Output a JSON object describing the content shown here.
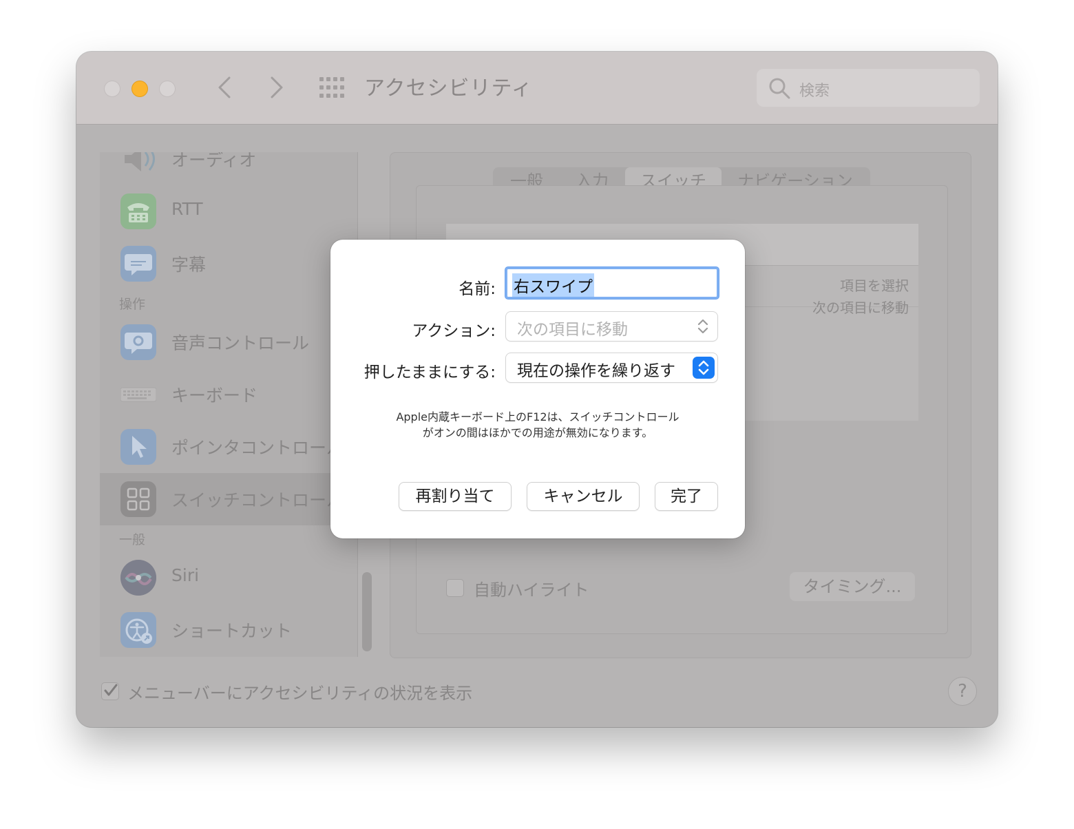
{
  "window": {
    "title": "アクセシビリティ",
    "search_placeholder": "検索"
  },
  "sidebar": {
    "items": [
      {
        "label": "オーディオ",
        "icon": "speaker-icon"
      },
      {
        "label": "RTT",
        "icon": "telephone-icon"
      },
      {
        "label": "字幕",
        "icon": "caption-bubble-icon"
      },
      {
        "label": "音声コントロール",
        "icon": "voice-control-icon"
      },
      {
        "label": "キーボード",
        "icon": "keyboard-icon"
      },
      {
        "label": "ポインタコントロール",
        "icon": "pointer-icon"
      },
      {
        "label": "スイッチコントロール",
        "icon": "switch-control-icon"
      },
      {
        "label": "Siri",
        "icon": "siri-icon"
      },
      {
        "label": "ショートカット",
        "icon": "accessibility-shortcut-icon"
      }
    ],
    "section_operation": "操作",
    "section_general": "一般"
  },
  "tabs": [
    "一般",
    "入力",
    "スイッチ",
    "ナビゲーション"
  ],
  "panel": {
    "rows": [
      "項目を選択",
      "次の項目に移動"
    ],
    "auto_highlight_label": "自動ハイライト",
    "timing_button": "タイミング..."
  },
  "bottom": {
    "show_status_label": "メニューバーにアクセシビリティの状況を表示",
    "help": "?"
  },
  "dialog": {
    "name_label": "名前:",
    "name_value": "右スワイプ",
    "action_label": "アクション:",
    "action_value": "次の項目に移動",
    "hold_label": "押したままにする:",
    "hold_value": "現在の操作を繰り返す",
    "note_line1": "Apple内蔵キーボード上のF12は、スイッチコントロール",
    "note_line2": "がオンの間はほかでの用途が無効になります。",
    "reassign_button": "再割り当て",
    "cancel_button": "キャンセル",
    "done_button": "完了"
  },
  "colors": {
    "accent": "#1a7cf5",
    "selection": "#b4d5fe",
    "minimize_light": "#fcb52e"
  }
}
